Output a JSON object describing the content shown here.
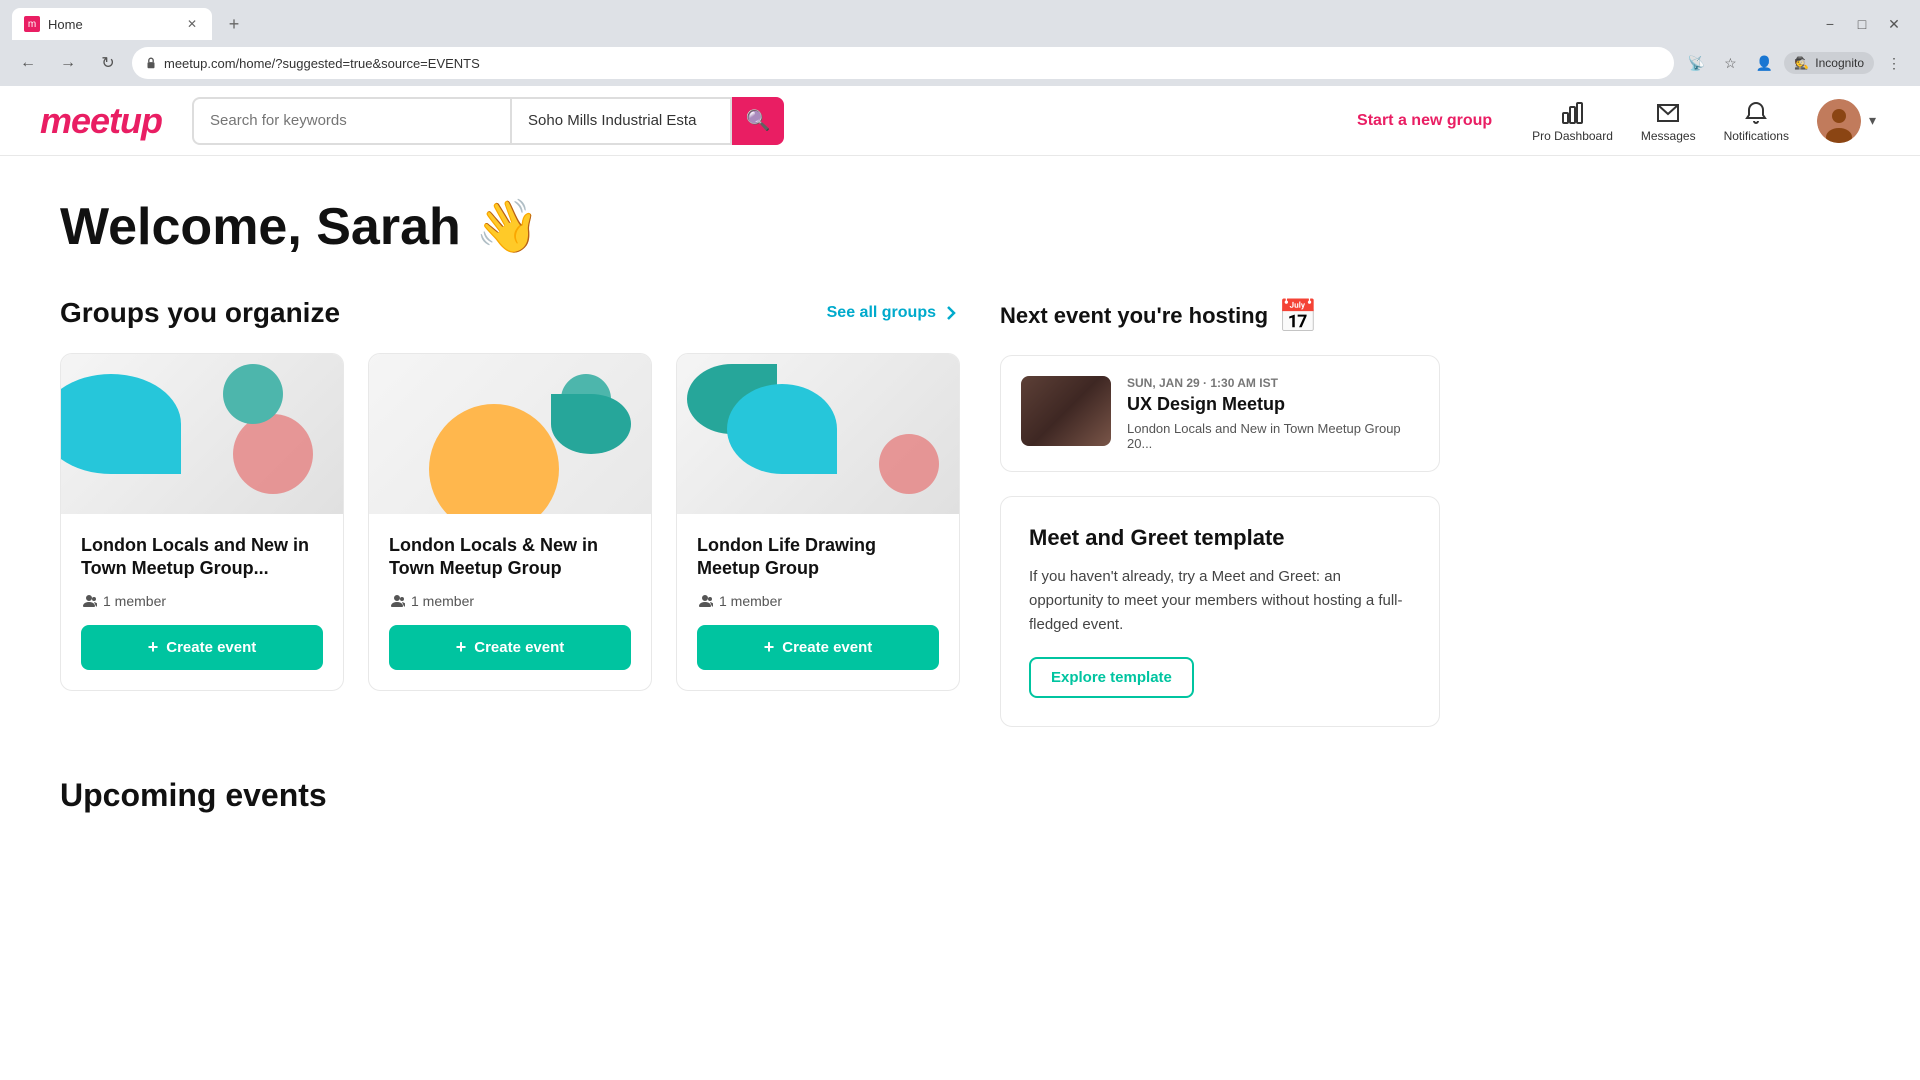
{
  "browser": {
    "tab_title": "Home",
    "url": "meetup.com/home/?suggested=true&source=EVENTS",
    "new_tab_label": "+",
    "incognito_label": "Incognito"
  },
  "header": {
    "logo": "meetup",
    "search_placeholder": "Search for keywords",
    "location_value": "Soho Mills Industrial Esta",
    "start_group_label": "Start a new group",
    "nav_items": [
      {
        "id": "pro-dashboard",
        "label": "Pro Dashboard"
      },
      {
        "id": "messages",
        "label": "Messages"
      },
      {
        "id": "notifications",
        "label": "Notifications"
      }
    ]
  },
  "welcome": {
    "greeting": "Welcome, Sarah 👋"
  },
  "groups_section": {
    "title": "Groups you organize",
    "see_all_label": "See all groups",
    "groups": [
      {
        "title": "London Locals and New in Town Meetup Group...",
        "members": "1 member",
        "create_event_label": "Create event"
      },
      {
        "title": "London Locals & New in Town Meetup Group",
        "members": "1 member",
        "create_event_label": "Create event"
      },
      {
        "title": "London Life Drawing Meetup Group",
        "members": "1 member",
        "create_event_label": "Create event"
      }
    ]
  },
  "next_event": {
    "section_title": "Next event you're hosting",
    "event": {
      "date": "SUN, JAN 29 · 1:30 AM IST",
      "title": "UX Design Meetup",
      "group": "London Locals and New in Town Meetup Group 20..."
    }
  },
  "template": {
    "title": "Meet and Greet template",
    "description": "If you haven't already, try a Meet and Greet: an opportunity to meet your members without hosting a full-fledged event.",
    "button_label": "Explore template"
  },
  "upcoming": {
    "title": "Upcoming events"
  }
}
